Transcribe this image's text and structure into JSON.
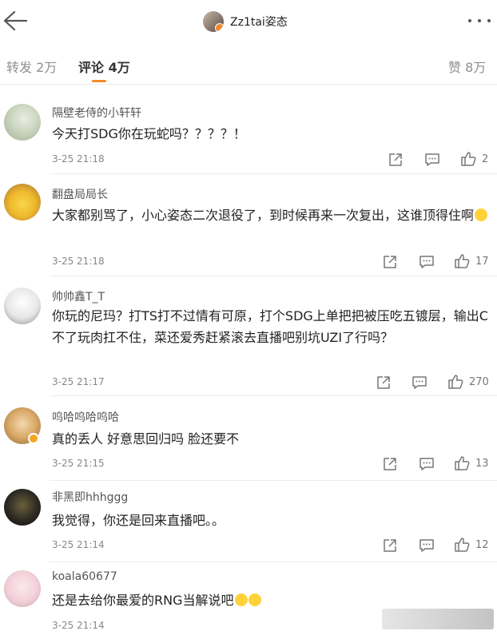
{
  "header": {
    "title": "Zz1tai姿态"
  },
  "tabs": [
    {
      "label": "转发 2万"
    },
    {
      "label": "评论 4万"
    },
    {
      "label": "赞 8万"
    }
  ],
  "comments": [
    {
      "username": "隔壁老侍的小轩轩",
      "text": "今天打SDG你在玩蛇吗？？？？！",
      "time": "3-25 21:18",
      "likes": "2"
    },
    {
      "username": "翻盘局局长",
      "text": "大家都别骂了，小心姿态二次退役了，到时候再来一次复出，这谁顶得住啊",
      "time": "3-25 21:18",
      "likes": "17"
    },
    {
      "username": "帅帅鑫T_T",
      "text": "你玩的尼玛？打TS打不过情有可原，打个SDG上单把把被压吃五镀层，输出C不了玩肉扛不住，菜还爱秀赶紧滚去直播吧别坑UZI了行吗？",
      "time": "3-25 21:17",
      "likes": "270"
    },
    {
      "username": "呜哈呜哈呜哈",
      "text": "真的丢人 好意思回归吗 脸还要不",
      "time": "3-25 21:15",
      "likes": "13"
    },
    {
      "username": "非黑即hhhggg",
      "text": "我觉得，你还是回来直播吧。。",
      "time": "3-25 21:14",
      "likes": "12"
    },
    {
      "username": "koala60677",
      "text": "还是去给你最爱的RNG当解说吧",
      "time": "3-25 21:14",
      "likes": ""
    }
  ],
  "icons": {
    "back": "back-arrow-icon",
    "more": "more-dots-icon",
    "share": "share-icon",
    "reply": "reply-icon",
    "like": "thumbs-up-icon"
  },
  "colors": {
    "accent": "#f68a2b",
    "vip_badge": "#f5a623"
  }
}
